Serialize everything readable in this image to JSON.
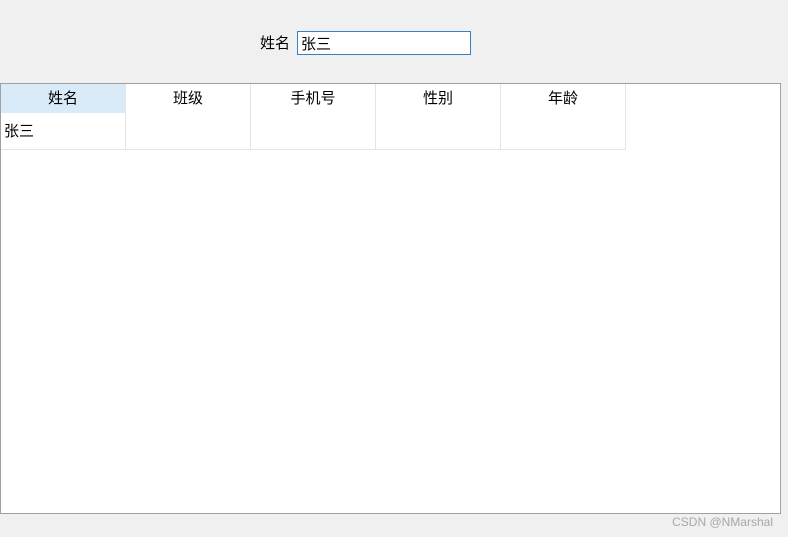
{
  "search": {
    "label": "姓名",
    "value": "张三"
  },
  "table": {
    "headers": [
      "姓名",
      "班级",
      "手机号",
      "性别",
      "年龄"
    ],
    "selected_header_index": 0,
    "rows": [
      [
        "张三",
        "",
        "",
        "",
        ""
      ]
    ]
  },
  "colors": {
    "input_border": "#3d7ebf",
    "header_selected_bg": "#d9ebf9",
    "window_bg": "#f0f0f0"
  },
  "watermark": "CSDN @NMarshal"
}
